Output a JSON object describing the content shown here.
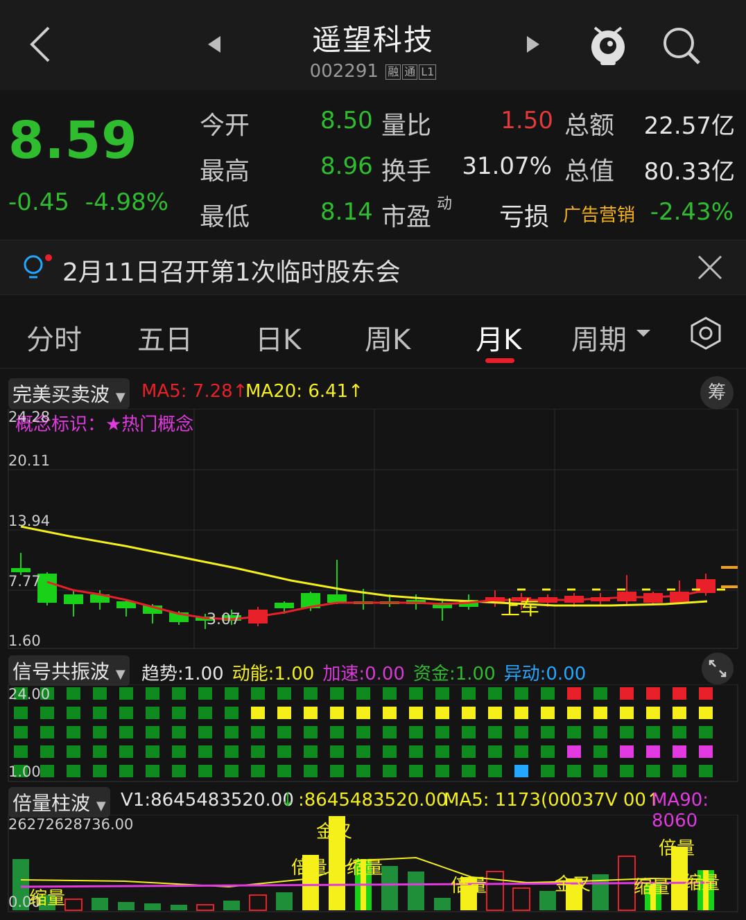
{
  "header": {
    "title": "遥望科技",
    "code": "002291",
    "tags": [
      "融",
      "通",
      "L1"
    ]
  },
  "quote": {
    "price": "8.59",
    "change": "-0.45",
    "change_pct": "-4.98%",
    "rows": [
      [
        {
          "label": "今开",
          "value": "8.50"
        },
        {
          "label": "量比",
          "value": "1.50"
        },
        {
          "label": "总额",
          "value": "22.57亿"
        }
      ],
      [
        {
          "label": "最高",
          "value": "8.96"
        },
        {
          "label": "换手",
          "value": "31.07%"
        },
        {
          "label": "总值",
          "value": "80.33亿"
        }
      ],
      [
        {
          "label": "最低",
          "value": "8.14"
        },
        {
          "label": "市盈",
          "value": "亏损",
          "sup": "动"
        },
        {
          "label": "广告营销",
          "value": "-2.43%"
        }
      ]
    ]
  },
  "notice": {
    "text": "2月11日召开第1次临时股东会"
  },
  "tabs": [
    "分时",
    "五日",
    "日K",
    "周K",
    "月K",
    "周期"
  ],
  "main_chart": {
    "selector": "完美买卖波",
    "ma5": "MA5: 7.28↑",
    "ma20": "MA20: 6.41↑",
    "chip_button": "筹",
    "concept": "概念标识：★热门概念",
    "y_labels": [
      "24.28",
      "20.11",
      "13.94",
      "7.77",
      "1.60"
    ],
    "low_label": "3.07",
    "annotation": "上车",
    "colors": {
      "up": "#e8202a",
      "down": "#19d119",
      "ma5": "#e8202a",
      "ma20": "#f5ef1a"
    }
  },
  "signal_chart": {
    "selector": "信号共振波",
    "metrics": [
      {
        "label": "趋势:",
        "value": "1.00",
        "color": "#e6e6e6"
      },
      {
        "label": "动能:",
        "value": "1.00",
        "color": "#f5ef1a"
      },
      {
        "label": "加速:",
        "value": "0.00",
        "color": "#d83ad8"
      },
      {
        "label": "资金:",
        "value": "1.00",
        "color": "#2fbd2f"
      },
      {
        "label": "异动:",
        "value": "0.00",
        "color": "#24a7ff"
      }
    ],
    "y_labels": [
      "24.00",
      "1.00"
    ]
  },
  "volume_chart": {
    "selector": "倍量柱波",
    "v1": "V1:8645483520.00",
    "v2": ":8645483520.00",
    "ma5": "MA5: 1173(00037V 00↑",
    "ma90": "MA90: 8060",
    "y_labels": [
      "26272628736.00",
      "0.00"
    ],
    "annotations": [
      "金叉",
      "倍量",
      "缩量",
      "倍量",
      "金叉",
      "倍量",
      "缩量",
      "缩量",
      "缩量"
    ]
  }
}
